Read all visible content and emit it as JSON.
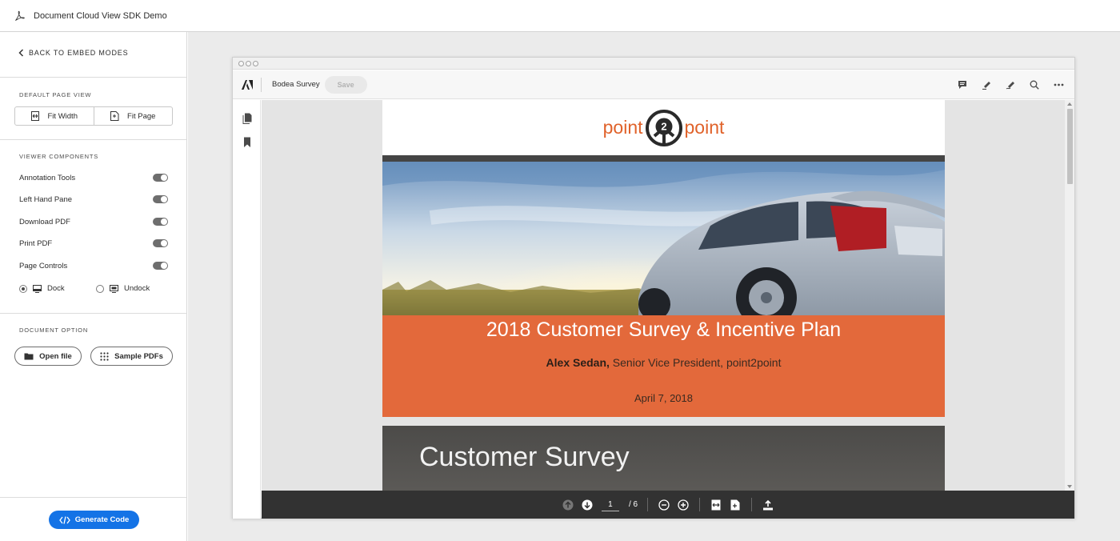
{
  "app": {
    "title": "Document Cloud View SDK Demo"
  },
  "sidebar": {
    "back_label": "BACK TO EMBED MODES",
    "default_page_view": {
      "heading": "DEFAULT PAGE VIEW",
      "fit_width": "Fit Width",
      "fit_page": "Fit Page"
    },
    "viewer_components": {
      "heading": "VIEWER COMPONENTS",
      "toggles": [
        {
          "label": "Annotation Tools",
          "on": true
        },
        {
          "label": "Left Hand Pane",
          "on": true
        },
        {
          "label": "Download PDF",
          "on": true
        },
        {
          "label": "Print PDF",
          "on": true
        },
        {
          "label": "Page Controls",
          "on": true
        }
      ],
      "dock_label": "Dock",
      "undock_label": "Undock",
      "selected_mode": "Dock"
    },
    "document_option": {
      "heading": "DOCUMENT OPTION",
      "open_file": "Open file",
      "sample_pdfs": "Sample PDFs"
    },
    "generate_code": "Generate Code"
  },
  "viewer": {
    "document_name": "Bodea Survey",
    "save_label": "Save",
    "toolbar_icons": [
      "comment-icon",
      "highlight-icon",
      "draw-icon",
      "search-icon",
      "more-icon"
    ],
    "left_pane_icons": [
      "pages-icon",
      "bookmark-icon"
    ],
    "page1": {
      "brand_left": "point",
      "brand_badge": "2",
      "brand_right": "point",
      "title": "2018 Customer Survey & Incentive Plan",
      "author_name": "Alex Sedan,",
      "author_role": " Senior Vice President, point2point",
      "date": "April 7, 2018"
    },
    "page2": {
      "title": "Customer Survey"
    },
    "page_controls": {
      "current_page": "1",
      "total_pages": "/ 6"
    }
  },
  "colors": {
    "accent": "#1473e6",
    "brand_orange": "#e3693b",
    "bar_dark": "#323232"
  }
}
